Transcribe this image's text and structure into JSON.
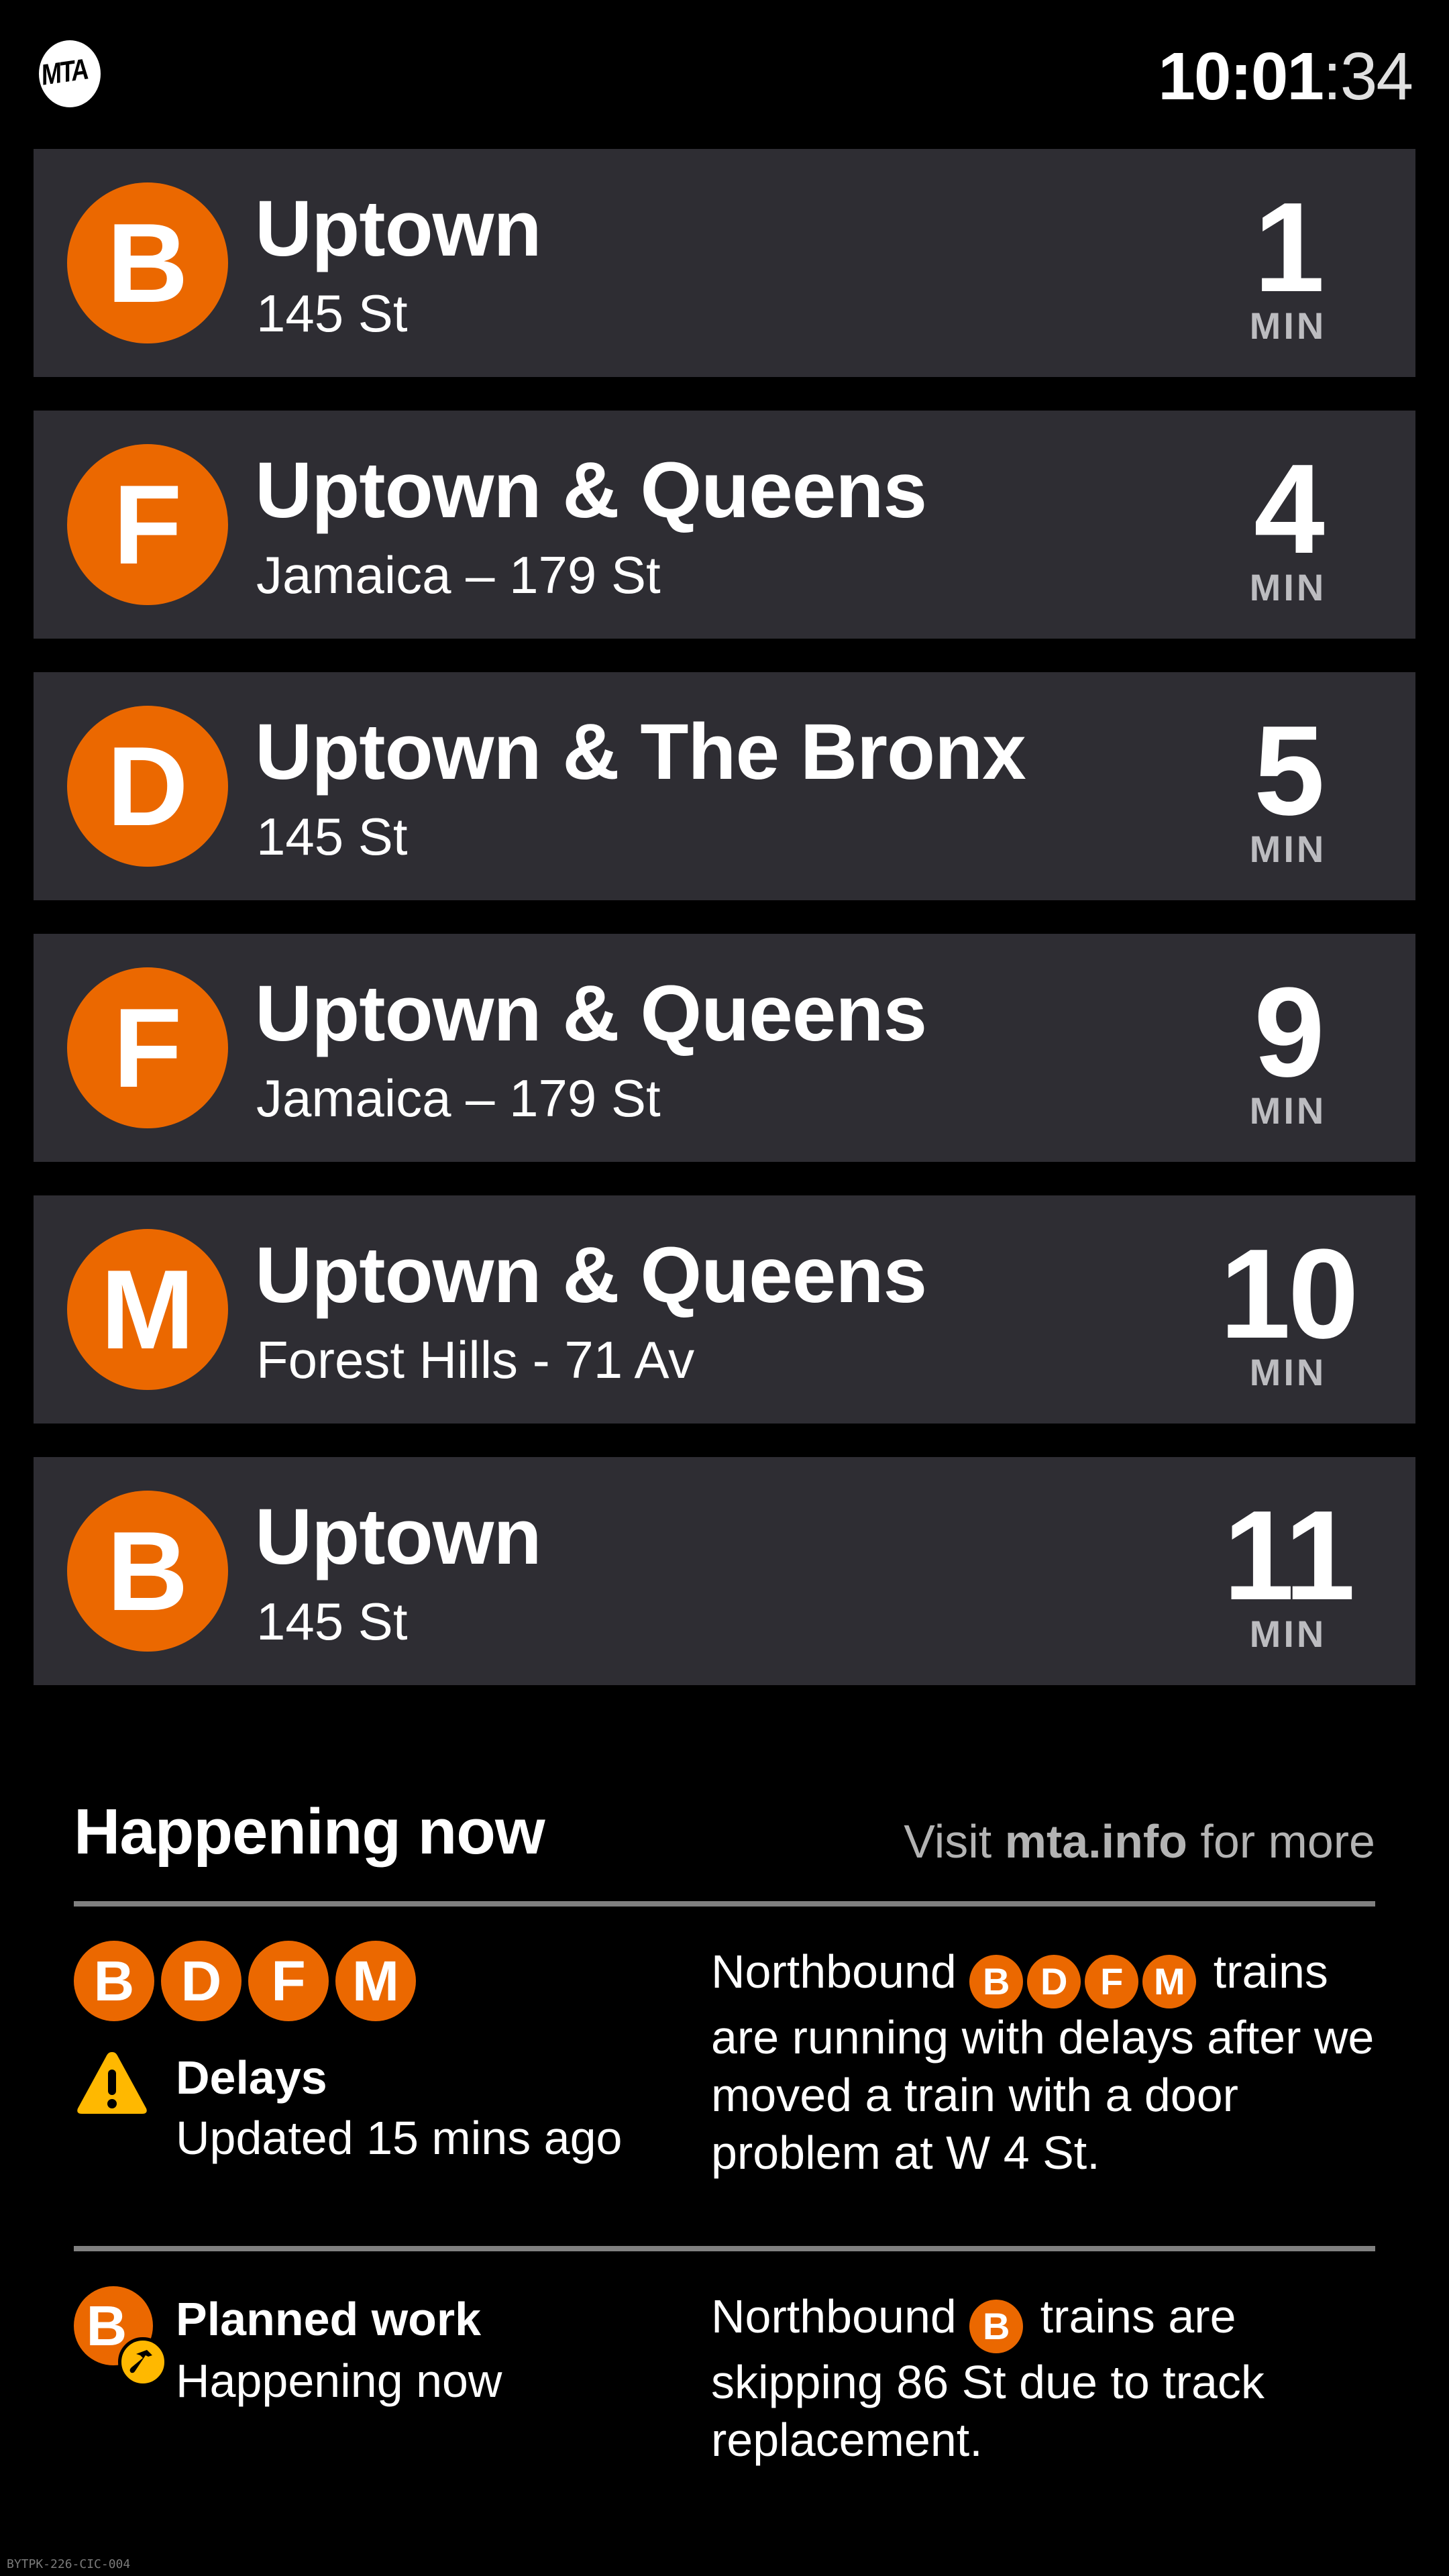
{
  "header": {
    "logo_text": "MTA",
    "clock": {
      "hours_minutes": "10:01",
      "seconds": ":34"
    }
  },
  "arrivals": [
    {
      "route": "B",
      "direction": "Uptown",
      "terminal": "145 St",
      "minutes": "1",
      "unit": "MIN"
    },
    {
      "route": "F",
      "direction": "Uptown & Queens",
      "terminal": "Jamaica – 179 St",
      "minutes": "4",
      "unit": "MIN"
    },
    {
      "route": "D",
      "direction": "Uptown & The Bronx",
      "terminal": "145 St",
      "minutes": "5",
      "unit": "MIN"
    },
    {
      "route": "F",
      "direction": "Uptown & Queens",
      "terminal": "Jamaica – 179 St",
      "minutes": "9",
      "unit": "MIN"
    },
    {
      "route": "M",
      "direction": "Uptown & Queens",
      "terminal": "Forest Hills - 71 Av",
      "minutes": "10",
      "unit": "MIN"
    },
    {
      "route": "B",
      "direction": "Uptown",
      "terminal": "145 St",
      "minutes": "11",
      "unit": "MIN"
    }
  ],
  "happening_now": {
    "title": "Happening now",
    "link_prefix": "Visit ",
    "link_text": "mta.info",
    "link_suffix": " for more",
    "alerts": [
      {
        "routes": [
          "B",
          "D",
          "F",
          "M"
        ],
        "icon": "warning-icon",
        "type": "Delays",
        "status": "Updated 15 mins ago",
        "text_before": "Northbound",
        "text_after": "trains are running with delays after we moved a train with a door problem at W 4 St."
      },
      {
        "routes": [
          "B"
        ],
        "icon": "hammer-icon",
        "type": "Planned work",
        "status": "Happening now",
        "text_before": "Northbound",
        "text_after": "trains are skipping 86 St due to track replacement."
      }
    ]
  },
  "footer": {
    "device_id": "BYTPK-226-CIC-004"
  },
  "colors": {
    "route_bullet": "#eb6800",
    "row_background": "#2e2d33",
    "alert_yellow": "#ffb800",
    "divider": "#808080"
  }
}
